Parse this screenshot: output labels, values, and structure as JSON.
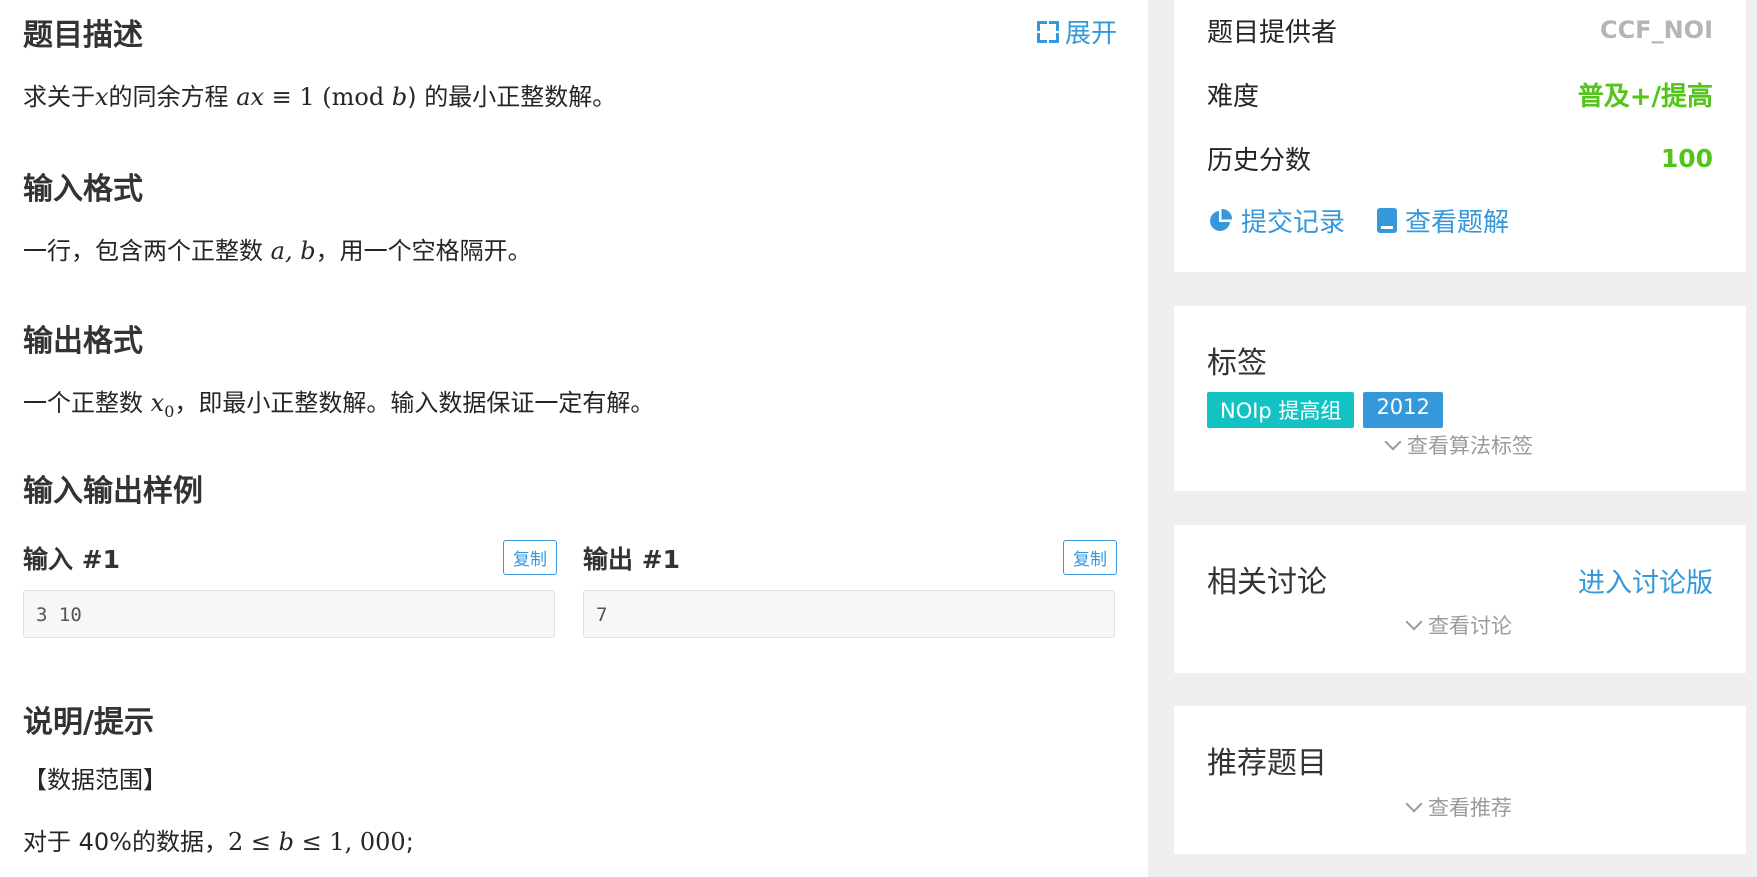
{
  "problem": {
    "description_heading": "题目描述",
    "expand_label": "展开",
    "description_parts": [
      "求关于",
      "x",
      "的同余方程 ",
      "ax",
      " ≡ 1  (mod ",
      "b",
      ") 的最小正整数解。"
    ],
    "input_heading": "输入格式",
    "input_parts": [
      "一行，包含两个正整数 ",
      "a, b",
      "，用一个空格隔开。"
    ],
    "output_heading": "输出格式",
    "output_parts": [
      "一个正整数 ",
      "x",
      "0",
      "，即最小正整数解。输入数据保证一定有解。"
    ],
    "samples_heading": "输入输出样例",
    "sample_input_label": "输入 #1",
    "sample_output_label": "输出 #1",
    "copy_label": "复制",
    "sample_input": "3 10",
    "sample_output": "7",
    "hint_heading": "说明/提示",
    "hint_range": "【数据范围】",
    "hint_line_parts": [
      "对于 40%的数据，",
      "2 ≤ ",
      "b",
      " ≤ 1, 000",
      ";"
    ]
  },
  "sidebar": {
    "provider_label": "题目提供者",
    "provider_value": "CCF_NOI",
    "difficulty_label": "难度",
    "difficulty_value": "普及+/提高",
    "score_label": "历史分数",
    "score_value": "100",
    "submissions_link": "提交记录",
    "solutions_link": "查看题解",
    "tags_title": "标签",
    "tags": [
      {
        "label": "NOIp 提高组",
        "color": "#13c2c2"
      },
      {
        "label": "2012",
        "color": "#3498db"
      }
    ],
    "view_algorithm_tags": "查看算法标签",
    "discussion_title": "相关讨论",
    "enter_forum": "进入讨论版",
    "view_discussion": "查看讨论",
    "recommend_title": "推荐题目",
    "view_recommend": "查看推荐"
  },
  "colors": {
    "accent": "#3498db",
    "difficulty": "#52c41a",
    "score": "#52c41a",
    "muted": "#b5b5b5"
  }
}
